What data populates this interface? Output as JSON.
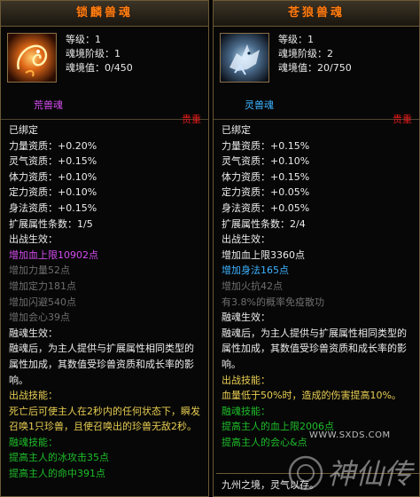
{
  "left": {
    "title": "锁麟兽魂",
    "level": "等级：1",
    "realm_stage": "魂境阶级：1",
    "realm_value": "魂境值：0/450",
    "type_label": "荒兽魂",
    "tag": "贵重",
    "lines": [
      {
        "text": "已绑定",
        "color": "white"
      },
      {
        "text": "力量资质：+0.20%",
        "color": "white"
      },
      {
        "text": "灵气资质：+0.15%",
        "color": "white"
      },
      {
        "text": "体力资质：+0.10%",
        "color": "white"
      },
      {
        "text": "定力资质：+0.10%",
        "color": "white"
      },
      {
        "text": "身法资质：+0.15%",
        "color": "white"
      },
      {
        "text": "扩展属性条数：1/5",
        "color": "white"
      },
      {
        "text": "出战生效：",
        "color": "white"
      },
      {
        "text": "增加血上限10902点",
        "color": "purple"
      },
      {
        "text": "增加力量52点",
        "color": "gray"
      },
      {
        "text": "增加定力181点",
        "color": "gray"
      },
      {
        "text": "增加闪避540点",
        "color": "gray"
      },
      {
        "text": "增加会心39点",
        "color": "gray"
      },
      {
        "text": "融魂生效：",
        "color": "white"
      },
      {
        "text": "融魂后，为主人提供与扩展属性相同类型的属性加成，其数值受珍兽资质和成长率的影响。",
        "color": "white",
        "wrap": true
      },
      {
        "text": "出战技能：",
        "color": "yellow"
      },
      {
        "text": "死亡后可使主人在2秒内的任何状态下，瞬发召唤1只珍兽，且使召唤出的珍兽无敌2秒。",
        "color": "yellow",
        "wrap": true
      },
      {
        "text": "融魂技能：",
        "color": "green"
      },
      {
        "text": "提高主人的冰攻击35点",
        "color": "green"
      },
      {
        "text": "提高主人的命中391点",
        "color": "green"
      }
    ]
  },
  "right": {
    "title": "苍狼兽魂",
    "level": "等级：1",
    "realm_stage": "魂境阶级：2",
    "realm_value": "魂境值：20/750",
    "type_label": "灵兽魂",
    "tag": "贵重",
    "lines": [
      {
        "text": "已绑定",
        "color": "white"
      },
      {
        "text": "力量资质：+0.15%",
        "color": "white"
      },
      {
        "text": "灵气资质：+0.10%",
        "color": "white"
      },
      {
        "text": "体力资质：+0.15%",
        "color": "white"
      },
      {
        "text": "定力资质：+0.05%",
        "color": "white"
      },
      {
        "text": "身法资质：+0.05%",
        "color": "white"
      },
      {
        "text": "扩展属性条数：2/4",
        "color": "white"
      },
      {
        "text": "出战生效：",
        "color": "white"
      },
      {
        "text": "增加血上限3360点",
        "color": "white"
      },
      {
        "text": "增加身法165点",
        "color": "blue"
      },
      {
        "text": "增加火抗42点",
        "color": "gray"
      },
      {
        "text": "有3.8%的概率免疫散功",
        "color": "gray"
      },
      {
        "text": "融魂生效：",
        "color": "white"
      },
      {
        "text": "融魂后，为主人提供与扩展属性相同类型的属性加成，其数值受珍兽资质和成长率的影响。",
        "color": "white",
        "wrap": true
      },
      {
        "text": "出战技能：",
        "color": "yellow"
      },
      {
        "text": "血量低于50%时，造成的伤害提高10%。",
        "color": "yellow"
      },
      {
        "text": "融魂技能：",
        "color": "green"
      },
      {
        "text": "提高主人的血上限2006点",
        "color": "green"
      },
      {
        "text": "提高主人的会心&点",
        "color": "green"
      }
    ],
    "bottom_text": "九州之境，灵气以存。"
  },
  "watermark": {
    "url": "WWW.SXDS.COM",
    "logo_text": "神仙传"
  },
  "colors": {
    "title": "#ff7f10",
    "purple": "#d44cf0",
    "blue": "#3cb2ff",
    "gray": "#6e6e6e",
    "yellow": "#e8ce52",
    "green": "#1ebd2a",
    "red_tag": "#e01a1a",
    "border": "#6b5a35"
  }
}
